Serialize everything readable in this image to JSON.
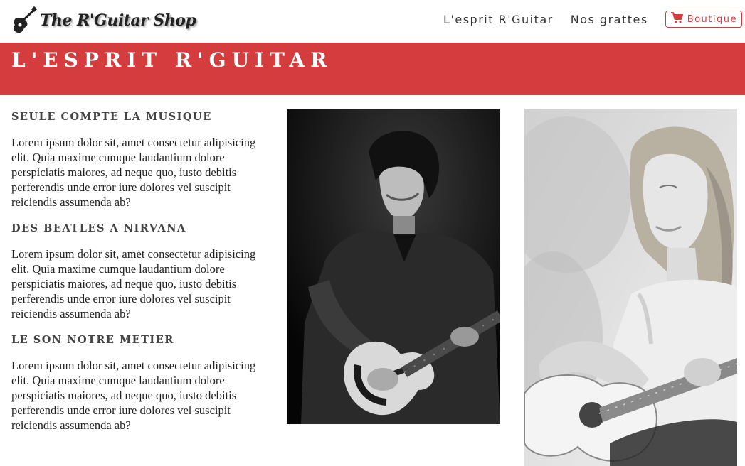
{
  "navbar": {
    "logo_text": "The R'Guitar Shop",
    "links": [
      {
        "label": "L'esprit R'Guitar"
      },
      {
        "label": "Nos grattes"
      }
    ],
    "shop_button": {
      "label": "Boutique",
      "icon": "cart-icon"
    }
  },
  "banner": {
    "title": "L'ESPRIT R'GUITAR"
  },
  "sections": [
    {
      "heading": "SEULE COMPTE LA MUSIQUE",
      "body": "Lorem ipsum dolor sit, amet consectetur adipisicing elit. Quia maxime cumque laudantium dolore perspiciatis maiores, ad neque quo, iusto debitis perferendis unde error iure dolores vel suscipit reiciendis assumenda ab?"
    },
    {
      "heading": "DES BEATLES A NIRVANA",
      "body": "Lorem ipsum dolor sit, amet consectetur adipisicing elit. Quia maxime cumque laudantium dolore perspiciatis maiores, ad neque quo, iusto debitis perferendis unde error iure dolores vel suscipit reiciendis assumenda ab?"
    },
    {
      "heading": "LE SON NOTRE METIER",
      "body": "Lorem ipsum dolor sit, amet consectetur adipisicing elit. Quia maxime cumque laudantium dolore perspiciatis maiores, ad neque quo, iusto debitis perferendis unde error iure dolores vel suscipit reiciendis assumenda ab?"
    }
  ],
  "colors": {
    "accent": "#d43c3e",
    "text": "#333333",
    "background": "#ffffff"
  }
}
